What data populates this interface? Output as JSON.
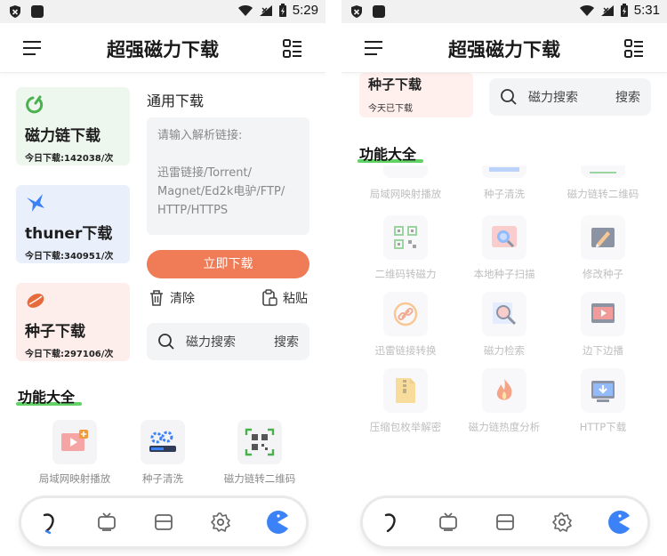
{
  "status": {
    "left_time": "5:29",
    "right_time": "5:31"
  },
  "app": {
    "title": "超强磁力下载"
  },
  "cards": [
    {
      "title": "磁力链下载",
      "stat": "今日下载:142038/次"
    },
    {
      "title": "thuner下载",
      "stat": "今日下载:340951/次"
    },
    {
      "title": "种子下载",
      "stat": "今日下载:297106/次"
    }
  ],
  "general": {
    "title": "通用下载",
    "placeholder_line1": "请输入解析链接:",
    "placeholder_line2": "迅雷链接/Torrent/",
    "placeholder_line3": "Magnet/Ed2k电驴/FTP/",
    "placeholder_line4": "HTTP/HTTPS",
    "download_button": "立即下载",
    "clear": "清除",
    "paste": "粘贴"
  },
  "search": {
    "label": "磁力搜索",
    "button": "搜索"
  },
  "features": {
    "title": "功能大全",
    "row1": [
      "局域网映射播放",
      "种子清洗",
      "磁力链转二维码"
    ],
    "row2": [
      "二维码转磁力",
      "本地种子扫描",
      "修改种子"
    ],
    "row3": [
      "迅雷链接转换",
      "磁力检索",
      "边下边播"
    ],
    "row4": [
      "压缩包枚举解密",
      "磁力链热度分析",
      "HTTP下载"
    ]
  },
  "right_card": {
    "title": "种子下载",
    "stat": "今天已下载"
  },
  "colors": {
    "accent": "#f07b57",
    "green": "#46c94b",
    "blue": "#3b82f6"
  }
}
